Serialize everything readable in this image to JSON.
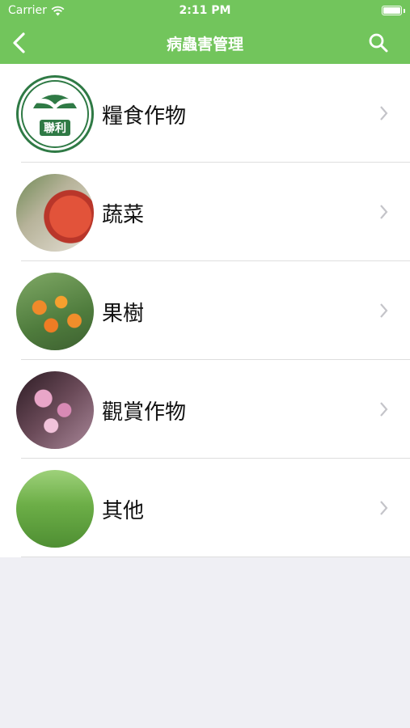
{
  "status_bar": {
    "carrier": "Carrier",
    "time": "2:11 PM"
  },
  "nav": {
    "title": "病蟲害管理"
  },
  "logo_text": "聯利",
  "categories": [
    {
      "label": "糧食作物",
      "icon": "lianli-logo"
    },
    {
      "label": "蔬菜",
      "icon": "vegetable-photo"
    },
    {
      "label": "果樹",
      "icon": "fruit-tree-photo"
    },
    {
      "label": "觀賞作物",
      "icon": "ornamental-photo"
    },
    {
      "label": "其他",
      "icon": "grass-photo"
    }
  ],
  "colors": {
    "header_bg": "#72c55c",
    "page_bg": "#efeff4",
    "separator": "#dedede",
    "chevron": "#c4c4c9"
  }
}
